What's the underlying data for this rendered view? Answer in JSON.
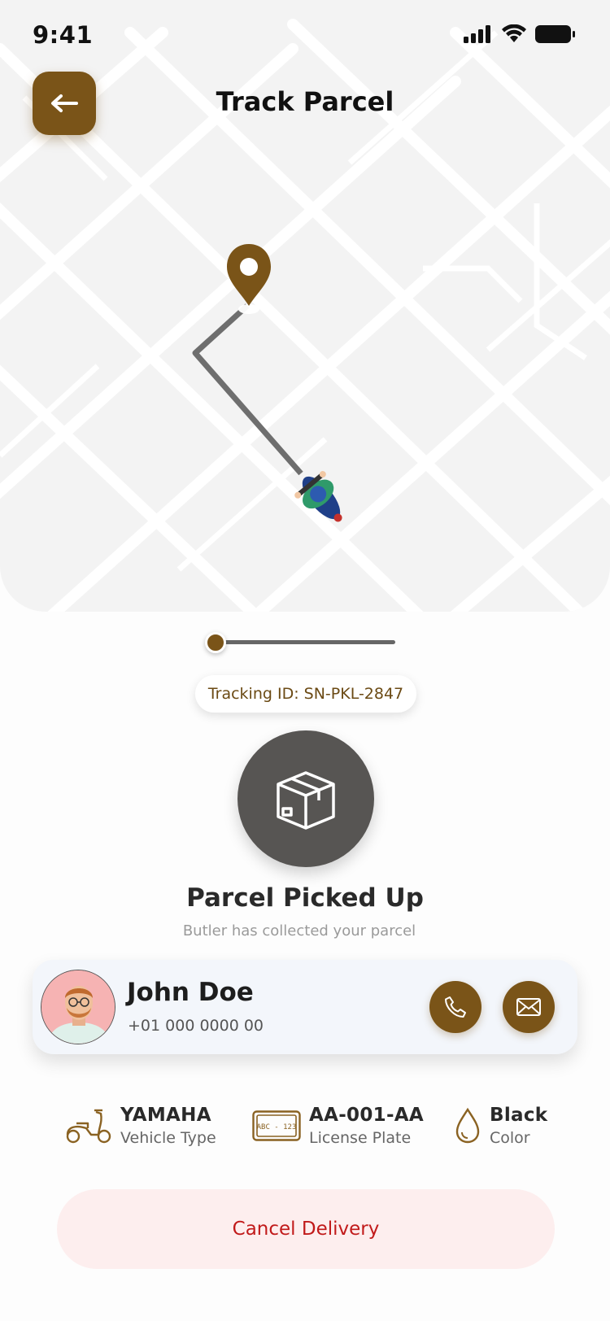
{
  "status_bar": {
    "time": "9:41"
  },
  "header": {
    "title": "Track Parcel"
  },
  "tracking": {
    "label": "Tracking ID: SN-PKL-2847",
    "progress": 0.0
  },
  "status": {
    "title": "Parcel Picked Up",
    "subtitle": "Butler has collected your parcel",
    "icon": "package-icon"
  },
  "driver": {
    "name": "John Doe",
    "phone": "+01 000 0000 00"
  },
  "vehicle": [
    {
      "value": "YAMAHA",
      "label": "Vehicle Type",
      "icon": "scooter-icon"
    },
    {
      "value": "AA-001-AA",
      "label": "License Plate",
      "icon": "license-plate-icon",
      "plate_text": "ABC - 123"
    },
    {
      "value": "Black",
      "label": "Color",
      "icon": "droplet-icon"
    }
  ],
  "actions": {
    "cancel": "Cancel Delivery"
  },
  "colors": {
    "accent": "#7a5418",
    "status_circle": "#575553",
    "cancel_bg": "#fdeeee",
    "cancel_text": "#c11a1a"
  }
}
